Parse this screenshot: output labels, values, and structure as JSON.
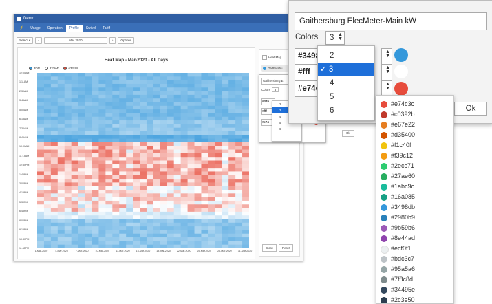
{
  "app": {
    "title": "Demo",
    "nav": [
      "Usage",
      "Operation",
      "Profile",
      "Swivel",
      "Tariff"
    ],
    "active_nav": "Profile"
  },
  "toolbar": {
    "select_label": "Select ▾",
    "prev": "‹",
    "date_value": "Mar 2020",
    "next": "›",
    "options_label": "Options"
  },
  "side_panel": {
    "heatmap_label": "Heat Map",
    "series_label": "Gaithersbu",
    "close_label": "Close",
    "reset_label": "Reset"
  },
  "mini_dialog": {
    "title": "Gaithersburg E",
    "colors_label": "Colors",
    "count": "3",
    "rows": [
      "#349",
      "#fff",
      "#e74"
    ],
    "ok_label": "Ok",
    "menu": [
      "2",
      "3",
      "4",
      "5",
      "6"
    ]
  },
  "chart_data": {
    "type": "heatmap",
    "title": "Heat Map - Mar-2020 - All Days",
    "legend": [
      {
        "label": "3kW",
        "color": "#3498db"
      },
      {
        "label": "333kW",
        "color": "#ffffff"
      },
      {
        "label": "633kW",
        "color": "#e74c3c"
      }
    ],
    "color_scale": [
      "#3498db",
      "#ffffff",
      "#e74c3c"
    ],
    "y_tick_labels": [
      "12:00AM",
      "1:11AM",
      "2:30AM",
      "3:45AM",
      "5:00AM",
      "6:15AM",
      "7:30AM",
      "8:45AM",
      "10:00AM",
      "11:15AM",
      "12:30PM",
      "1:45PM",
      "3:00PM",
      "4:15PM",
      "5:30PM",
      "6:45PM",
      "8:00PM",
      "9:15PM",
      "10:30PM",
      "11:45PM"
    ],
    "x_tick_labels": [
      "1-Mar-2020",
      "4-Mar-2020",
      "7-Mar-2020",
      "10-Mar-2020",
      "13-Mar-2020",
      "16-Mar-2020",
      "19-Mar-2020",
      "22-Mar-2020",
      "25-Mar-2020",
      "28-Mar-2020",
      "31-Mar-2020"
    ],
    "x_range": [
      "1-Mar-2020",
      "31-Mar-2020"
    ],
    "y_range": [
      "12:00AM",
      "11:45PM"
    ],
    "value_range_kw": [
      3,
      633
    ],
    "band_profile": {
      "12:00AM-8:45AM": "low (blue)",
      "9:30AM-7:00PM": "high (red to white)",
      "7:30PM-11:45PM": "low (blue)"
    }
  },
  "dialog": {
    "title_value": "Gaithersburg ElecMeter-Main kW",
    "colors_label": "Colors",
    "count": "3",
    "rows": [
      {
        "value": "#3498",
        "swatch": "#3498db"
      },
      {
        "value": "#fff",
        "swatch": "#ffffff"
      },
      {
        "value": "#e74c",
        "swatch": "#e74c3c"
      }
    ],
    "ok_label": "Ok",
    "count_options": [
      "2",
      "3",
      "4",
      "5",
      "6"
    ],
    "selected_count": "3",
    "check_mark": "✓"
  },
  "palette": [
    {
      "label": "#e74c3c",
      "color": "#e74c3c"
    },
    {
      "label": "#c0392b",
      "color": "#c0392b"
    },
    {
      "label": "#e67e22",
      "color": "#e67e22"
    },
    {
      "label": "#d35400",
      "color": "#d35400"
    },
    {
      "label": "#f1c40f",
      "color": "#f1c40f"
    },
    {
      "label": "#f39c12",
      "color": "#f39c12"
    },
    {
      "label": "#2ecc71",
      "color": "#2ecc71"
    },
    {
      "label": "#27ae60",
      "color": "#27ae60"
    },
    {
      "label": "#1abc9c",
      "color": "#1abc9c"
    },
    {
      "label": "#16a085",
      "color": "#16a085"
    },
    {
      "label": "#3498db",
      "color": "#3498db"
    },
    {
      "label": "#2980b9",
      "color": "#2980b9"
    },
    {
      "label": "#9b59b6",
      "color": "#9b59b6"
    },
    {
      "label": "#8e44ad",
      "color": "#8e44ad"
    },
    {
      "label": "#ecf0f1",
      "color": "#ecf0f1"
    },
    {
      "label": "#bdc3c7",
      "color": "#bdc3c7"
    },
    {
      "label": "#95a5a6",
      "color": "#95a5a6"
    },
    {
      "label": "#7f8c8d",
      "color": "#7f8c8d"
    },
    {
      "label": "#34495e",
      "color": "#34495e"
    },
    {
      "label": "#2c3e50",
      "color": "#2c3e50"
    }
  ]
}
